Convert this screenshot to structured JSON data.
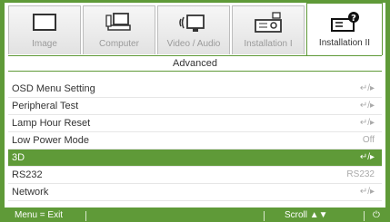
{
  "tabs": [
    {
      "label": "Image",
      "icon": "monitor-icon",
      "active": false
    },
    {
      "label": "Computer",
      "icon": "computer-icon",
      "active": false
    },
    {
      "label": "Video / Audio",
      "icon": "video-audio-icon",
      "active": false
    },
    {
      "label": "Installation I",
      "icon": "projector-icon",
      "active": false
    },
    {
      "label": "Installation II",
      "icon": "projector-settings-icon",
      "active": true
    }
  ],
  "section_title": "Advanced",
  "menu_items": [
    {
      "label": "OSD Menu Setting",
      "value": "↵/▸",
      "selected": false
    },
    {
      "label": "Peripheral Test",
      "value": "↵/▸",
      "selected": false
    },
    {
      "label": "Lamp Hour Reset",
      "value": "↵/▸",
      "selected": false
    },
    {
      "label": "Low Power Mode",
      "value": "Off",
      "selected": false
    },
    {
      "label": "3D",
      "value": "↵/▸",
      "selected": true
    },
    {
      "label": "RS232",
      "value": "RS232",
      "selected": false
    },
    {
      "label": "Network",
      "value": "↵/▸",
      "selected": false
    }
  ],
  "footer": {
    "menu_exit": "Menu = Exit",
    "scroll": "Scroll ▲▼",
    "power_glyph": "⏻"
  },
  "colors": {
    "accent": "#5f9a38",
    "tab_bg": "#e2e2e2",
    "muted_text": "#aaaaaa"
  }
}
